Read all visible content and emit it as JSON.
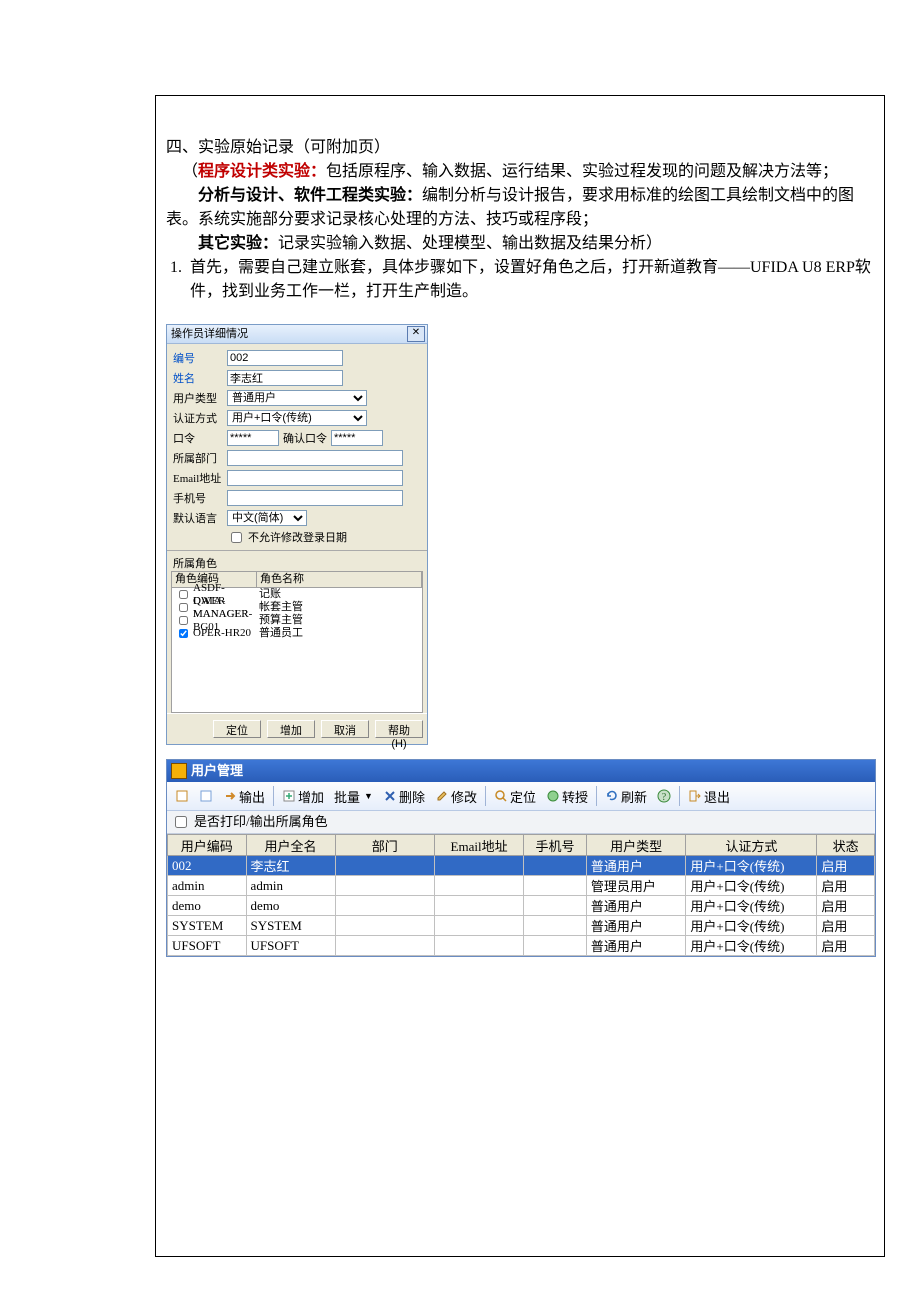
{
  "doc": {
    "h1": "四、实验原始记录（可附加页）",
    "p1a": "（",
    "p1b": "程序设计类实验：",
    "p1c": "包括原程序、输入数据、运行结果、实验过程发现的问题及解决方法等；",
    "p2a": "分析与设计、软件工程类实验：",
    "p2b": "编制分析与设计报告，要求用标准的绘图工具绘制文档中的图表。系统实施部分要求记录核心处理的方法、技巧或程序段；",
    "p3a": "其它实验：",
    "p3b": "记录实验输入数据、处理模型、输出数据及结果分析）",
    "li1_num": "1.",
    "li1": "首先，需要自己建立账套，具体步骤如下，设置好角色之后，打开新道教育——UFIDA U8    ERP软件，找到业务工作一栏，打开生产制造。"
  },
  "dlg": {
    "title": "操作员详细情况",
    "close": "✕",
    "labels": {
      "code": "编号",
      "name": "姓名",
      "utype": "用户类型",
      "auth": "认证方式",
      "pwd": "口令",
      "pwd2": "确认口令",
      "dept": "所属部门",
      "email": "Email地址",
      "phone": "手机号",
      "lang": "默认语言",
      "lock": "不允许修改登录日期",
      "roles": "所属角色"
    },
    "values": {
      "code": "002",
      "name": "李志红",
      "utype": "普通用户",
      "auth": "用户+口令(传统)",
      "pwd": "*****",
      "pwd2": "*****",
      "lang": "中文(简体)"
    },
    "grid": {
      "h1": "角色编码",
      "h2": "角色名称",
      "rows": [
        {
          "code": "ASDF-QWER",
          "name": "记账",
          "checked": false
        },
        {
          "code": "DATA-MANAGER",
          "name": "帐套主管",
          "checked": false
        },
        {
          "code": "MANAGER-BG01",
          "name": "预算主管",
          "checked": false
        },
        {
          "code": "OPER-HR20",
          "name": "普通员工",
          "checked": true
        }
      ]
    },
    "buttons": {
      "locate": "定位",
      "add": "增加",
      "cancel": "取消",
      "help": "帮助(H)"
    }
  },
  "mgr": {
    "title": "用户管理",
    "toolbar": {
      "export": "输出",
      "add": "增加",
      "batch": "批量",
      "delete": "删除",
      "modify": "修改",
      "locate": "定位",
      "grant": "转授",
      "refresh": "刷新",
      "exit": "退出"
    },
    "subbar_label": "是否打印/输出所属角色",
    "headers": [
      "用户编码",
      "用户全名",
      "部门",
      "Email地址",
      "手机号",
      "用户类型",
      "认证方式",
      "状态"
    ],
    "rows": [
      {
        "code": "002",
        "name": "李志红",
        "dept": "",
        "email": "",
        "phone": "",
        "type": "普通用户",
        "auth": "用户+口令(传统)",
        "status": "启用",
        "sel": true
      },
      {
        "code": "admin",
        "name": "admin",
        "dept": "",
        "email": "",
        "phone": "",
        "type": "管理员用户",
        "auth": "用户+口令(传统)",
        "status": "启用"
      },
      {
        "code": "demo",
        "name": "demo",
        "dept": "",
        "email": "",
        "phone": "",
        "type": "普通用户",
        "auth": "用户+口令(传统)",
        "status": "启用"
      },
      {
        "code": "SYSTEM",
        "name": "SYSTEM",
        "dept": "",
        "email": "",
        "phone": "",
        "type": "普通用户",
        "auth": "用户+口令(传统)",
        "status": "启用"
      },
      {
        "code": "UFSOFT",
        "name": "UFSOFT",
        "dept": "",
        "email": "",
        "phone": "",
        "type": "普通用户",
        "auth": "用户+口令(传统)",
        "status": "启用"
      }
    ]
  }
}
